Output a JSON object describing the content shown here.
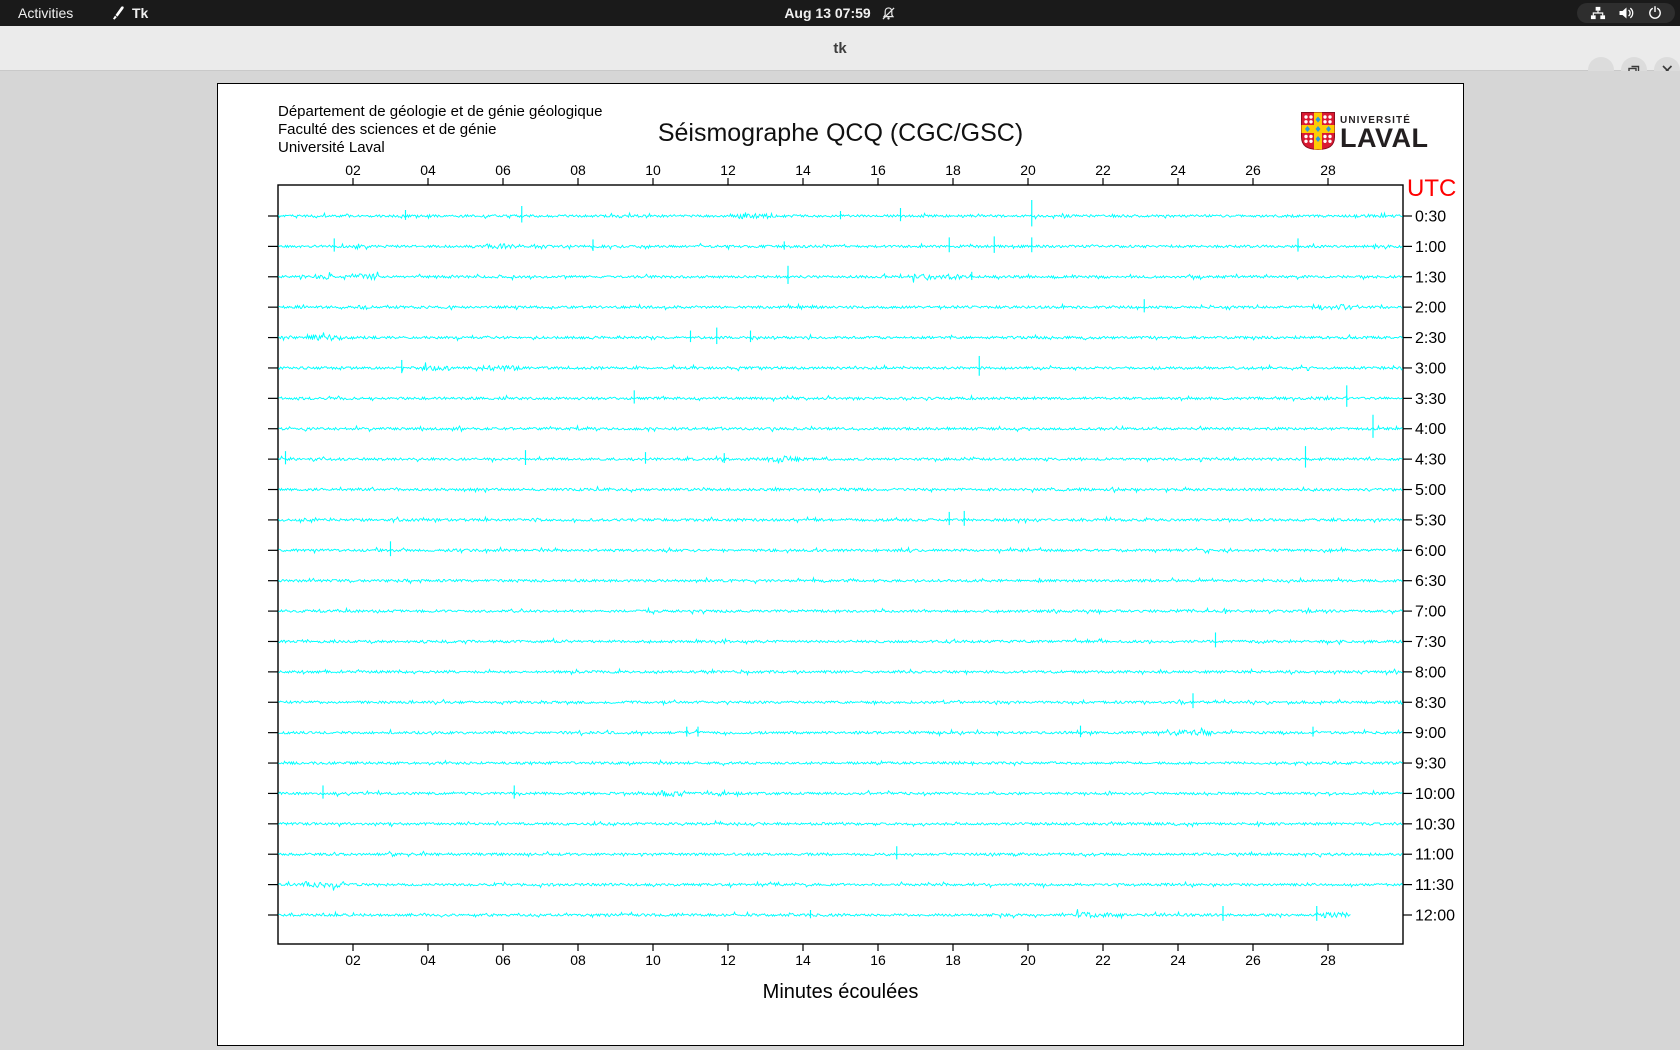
{
  "topbar": {
    "activities": "Activities",
    "app_name": "Tk",
    "clock": "Aug 13 07:59",
    "icons": [
      "tk-app-icon",
      "notifications-muted-icon",
      "network-icon",
      "volume-icon",
      "power-icon"
    ]
  },
  "titlebar": {
    "title": "tk",
    "buttons": [
      "minimize",
      "maximize",
      "close"
    ]
  },
  "figure": {
    "institution_lines": [
      "Département de géologie et de génie géologique",
      "Faculté des sciences et de génie",
      "Université Laval"
    ],
    "title": "Séismographe QCQ (CGC/GSC)",
    "utc_label": "UTC",
    "xlabel": "Minutes écoulées",
    "logo": {
      "line1": "UNIVERSITÉ",
      "line2": "LAVAL",
      "colors": {
        "red": "#da1a32",
        "yellow": "#ffcb05",
        "blue": "#2b9cd8"
      }
    }
  },
  "chart_data": {
    "type": "line",
    "title": "Séismographe QCQ (CGC/GSC)",
    "xlabel": "Minutes écoulées",
    "right_axis_label": "UTC",
    "x_range_minutes": [
      0,
      30
    ],
    "x_tick_minutes": [
      2,
      4,
      6,
      8,
      10,
      12,
      14,
      16,
      18,
      20,
      22,
      24,
      26,
      28
    ],
    "x_tick_labels": [
      "02",
      "04",
      "06",
      "08",
      "10",
      "12",
      "14",
      "16",
      "18",
      "20",
      "22",
      "24",
      "26",
      "28"
    ],
    "trace_color": "#00ffff",
    "noise_seed": 7,
    "grid": false,
    "legend": "none",
    "rows": [
      {
        "label": "0:30",
        "end": 30,
        "spikes": [
          [
            3.4,
            6
          ],
          [
            6.5,
            10
          ],
          [
            15.0,
            5
          ],
          [
            16.6,
            8
          ],
          [
            20.1,
            16
          ]
        ],
        "bursts": [
          [
            12.6,
            1.2,
            2.6
          ]
        ]
      },
      {
        "label": "1:00",
        "end": 30,
        "spikes": [
          [
            1.5,
            8
          ],
          [
            8.4,
            7
          ],
          [
            13.5,
            5
          ],
          [
            17.9,
            9
          ],
          [
            19.1,
            10
          ],
          [
            20.1,
            9
          ],
          [
            27.2,
            8
          ]
        ],
        "bursts": [
          [
            6.0,
            0.9,
            2.6
          ]
        ]
      },
      {
        "label": "1:30",
        "end": 30,
        "spikes": [
          [
            13.6,
            11
          ],
          [
            18.5,
            5
          ]
        ],
        "bursts": [
          [
            1.2,
            0.5,
            2.6
          ],
          [
            2.3,
            0.8,
            3.0
          ],
          [
            17.4,
            1.6,
            2.6
          ]
        ]
      },
      {
        "label": "2:00",
        "end": 30,
        "spikes": [
          [
            23.1,
            8
          ]
        ],
        "bursts": [
          [
            2.3,
            0.5,
            2.2
          ],
          [
            28.2,
            0.9,
            3.0
          ]
        ]
      },
      {
        "label": "2:30",
        "end": 30,
        "spikes": [
          [
            11.0,
            7
          ],
          [
            11.7,
            10
          ],
          [
            12.6,
            7
          ]
        ],
        "bursts": [
          [
            1.2,
            0.9,
            3.0
          ]
        ]
      },
      {
        "label": "3:00",
        "end": 30,
        "spikes": [
          [
            3.3,
            8
          ],
          [
            18.7,
            12
          ]
        ],
        "bursts": [
          [
            4.2,
            0.7,
            2.6
          ],
          [
            6.0,
            0.9,
            2.6
          ]
        ]
      },
      {
        "label": "3:30",
        "end": 30,
        "spikes": [
          [
            9.5,
            8
          ],
          [
            28.5,
            13
          ]
        ],
        "bursts": []
      },
      {
        "label": "4:00",
        "end": 30,
        "spikes": [
          [
            29.2,
            14
          ]
        ],
        "bursts": []
      },
      {
        "label": "4:30",
        "end": 30,
        "spikes": [
          [
            0.2,
            8
          ],
          [
            6.6,
            9
          ],
          [
            9.8,
            7
          ],
          [
            11.9,
            6
          ],
          [
            27.4,
            13
          ]
        ],
        "bursts": [
          [
            13.5,
            0.9,
            2.6
          ]
        ]
      },
      {
        "label": "5:00",
        "end": 30,
        "spikes": [],
        "bursts": []
      },
      {
        "label": "5:30",
        "end": 30,
        "spikes": [
          [
            17.9,
            8
          ],
          [
            18.3,
            9
          ]
        ],
        "bursts": []
      },
      {
        "label": "6:00",
        "end": 30,
        "spikes": [
          [
            3.0,
            9
          ]
        ],
        "bursts": []
      },
      {
        "label": "6:30",
        "end": 30,
        "spikes": [],
        "bursts": []
      },
      {
        "label": "7:00",
        "end": 30,
        "spikes": [],
        "bursts": []
      },
      {
        "label": "7:30",
        "end": 30,
        "spikes": [
          [
            25.0,
            9
          ]
        ],
        "bursts": []
      },
      {
        "label": "8:00",
        "end": 30,
        "spikes": [],
        "bursts": []
      },
      {
        "label": "8:30",
        "end": 30,
        "spikes": [
          [
            24.4,
            9
          ]
        ],
        "bursts": []
      },
      {
        "label": "9:00",
        "end": 30,
        "spikes": [
          [
            10.9,
            6
          ],
          [
            11.2,
            6
          ],
          [
            21.4,
            7
          ],
          [
            27.6,
            6
          ]
        ],
        "bursts": [
          [
            24.3,
            1.2,
            3.0
          ]
        ]
      },
      {
        "label": "9:30",
        "end": 30,
        "spikes": [],
        "bursts": []
      },
      {
        "label": "10:00",
        "end": 30,
        "spikes": [
          [
            1.2,
            8
          ],
          [
            6.3,
            8
          ]
        ],
        "bursts": [
          [
            10.5,
            0.7,
            3.0
          ]
        ]
      },
      {
        "label": "10:30",
        "end": 30,
        "spikes": [],
        "bursts": []
      },
      {
        "label": "11:00",
        "end": 30,
        "spikes": [
          [
            16.5,
            8
          ]
        ],
        "bursts": []
      },
      {
        "label": "11:30",
        "end": 30,
        "spikes": [],
        "bursts": [
          [
            1.2,
            1.1,
            3.0
          ]
        ]
      },
      {
        "label": "12:00",
        "end": 28.6,
        "spikes": [
          [
            14.2,
            5
          ],
          [
            25.2,
            9
          ],
          [
            27.7,
            9
          ]
        ],
        "bursts": [
          [
            21.8,
            1.1,
            2.6
          ],
          [
            28.2,
            0.7,
            3.0
          ]
        ]
      }
    ]
  }
}
